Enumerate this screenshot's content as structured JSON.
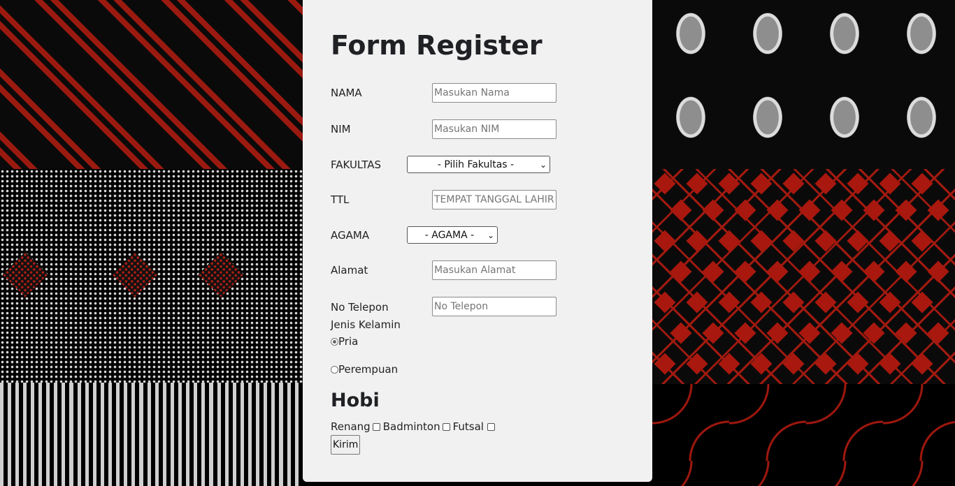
{
  "form": {
    "title": "Form Register",
    "fields": {
      "nama": {
        "label": "NAMA",
        "placeholder": "Masukan Nama"
      },
      "nim": {
        "label": "NIM",
        "placeholder": "Masukan NIM"
      },
      "fakultas": {
        "label": "FAKULTAS",
        "selected": "- Pilih Fakultas -"
      },
      "ttl": {
        "label": "TTL",
        "placeholder": "TEMPAT TANGGAL LAHIR"
      },
      "agama": {
        "label": "AGAMA",
        "selected": "- AGAMA -"
      },
      "alamat": {
        "label": "Alamat",
        "placeholder": "Masukan Alamat"
      },
      "telepon": {
        "label": "No Telepon",
        "placeholder": "No Telepon"
      }
    },
    "gender": {
      "label": "Jenis Kelamin",
      "options": [
        {
          "label": "Pria",
          "checked": true
        },
        {
          "label": "Perempuan",
          "checked": false
        }
      ]
    },
    "hobi": {
      "title": "Hobi",
      "options": [
        {
          "label": "Renang",
          "checked": false
        },
        {
          "label": "Badminton",
          "checked": false
        },
        {
          "label": "Futsal",
          "checked": false
        }
      ]
    },
    "submit_label": "Kirim"
  },
  "colors": {
    "card_bg": "#f1f1f1",
    "batik_red": "#9b1a10",
    "batik_black": "#0a0a0a"
  }
}
